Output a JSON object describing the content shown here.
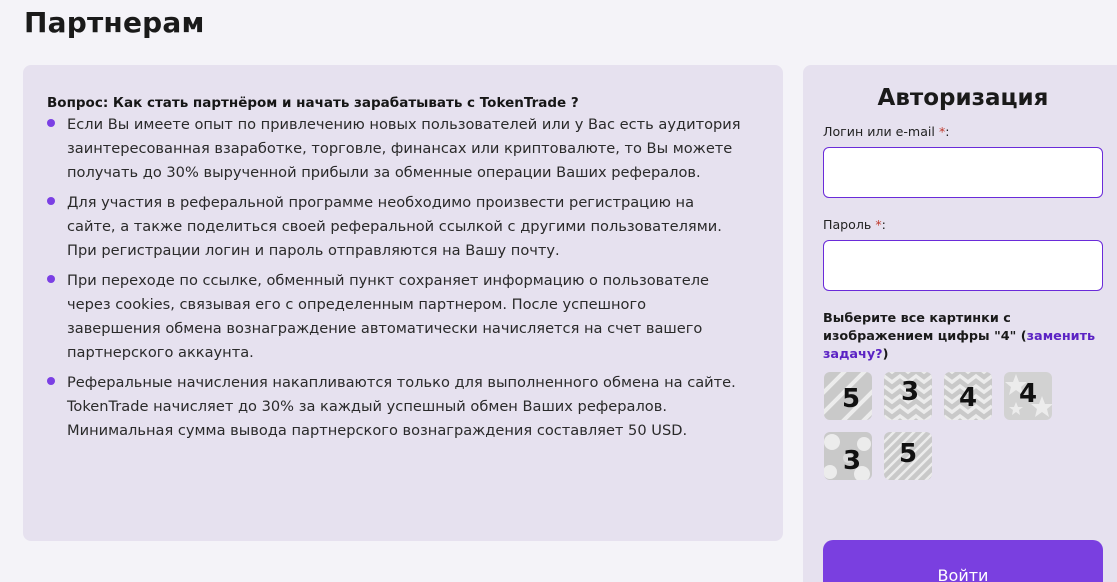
{
  "page": {
    "title": "Партнерам"
  },
  "info": {
    "question": "Вопрос: Как стать партнёром и начать зарабатывать с TokenTrade ?",
    "items": [
      {
        "line1": "Если Вы имеете опыт по привлечению новых пользователей или у Вас есть аудитория",
        "line2": "заинтересованная взаработке, торговле, финансах или криптовалюте, то Вы можете",
        "line3": "получать до 30% вырученной прибыли за обменные операции Ваших рефералов.",
        "line4": ""
      },
      {
        "line1": "Для участия в реферальной программе необходимо произвести регистрацию на",
        "line2": "сайте, а также поделиться своей реферальной ссылкой с другими пользователями.",
        "line3": "При регистрации логин и пароль отправляются на Вашу почту.",
        "line4": ""
      },
      {
        "line1": "При переходе по ссылке, обменный пункт сохраняет информацию о пользователе",
        "line2": "через cookies, связывая его с определенным партнером. После успешного",
        "line3": "завершения обмена вознаграждение автоматически начисляется на счет вашего",
        "line4": "партнерского аккаунта."
      },
      {
        "line1": "Реферальные начисления накапливаются только для выполненного обмена на сайте.",
        "line2": "TokenTrade начисляет до 30% за каждый успешный обмен Ваших рефералов.",
        "line3": "Минимальная сумма вывода партнерского вознаграждения составляет 50 USD.",
        "line4": ""
      }
    ]
  },
  "auth": {
    "title": "Авторизация",
    "login_label": "Логин или e-mail",
    "login_value": "",
    "password_label": "Пароль",
    "password_value": "",
    "required_mark": "*",
    "label_suffix": ":",
    "captcha_prefix": "Выберите все картинки с изображением цифры \"4\" (",
    "captcha_link": "заменить задачу?",
    "captcha_suffix": ")",
    "captcha_tiles": [
      {
        "digit": "5",
        "pattern": "checker"
      },
      {
        "digit": "3",
        "pattern": "zigzag"
      },
      {
        "digit": "4",
        "pattern": "zigzag"
      },
      {
        "digit": "4",
        "pattern": "stars"
      },
      {
        "digit": "3",
        "pattern": "circles"
      },
      {
        "digit": "5",
        "pattern": "stripes"
      }
    ],
    "submit_label": "Войти"
  },
  "colors": {
    "accent": "#7a3fe0",
    "link": "#5b23c4",
    "card_bg": "#e6e1ef",
    "page_bg": "#f4f3f8",
    "required": "#c0392b"
  }
}
